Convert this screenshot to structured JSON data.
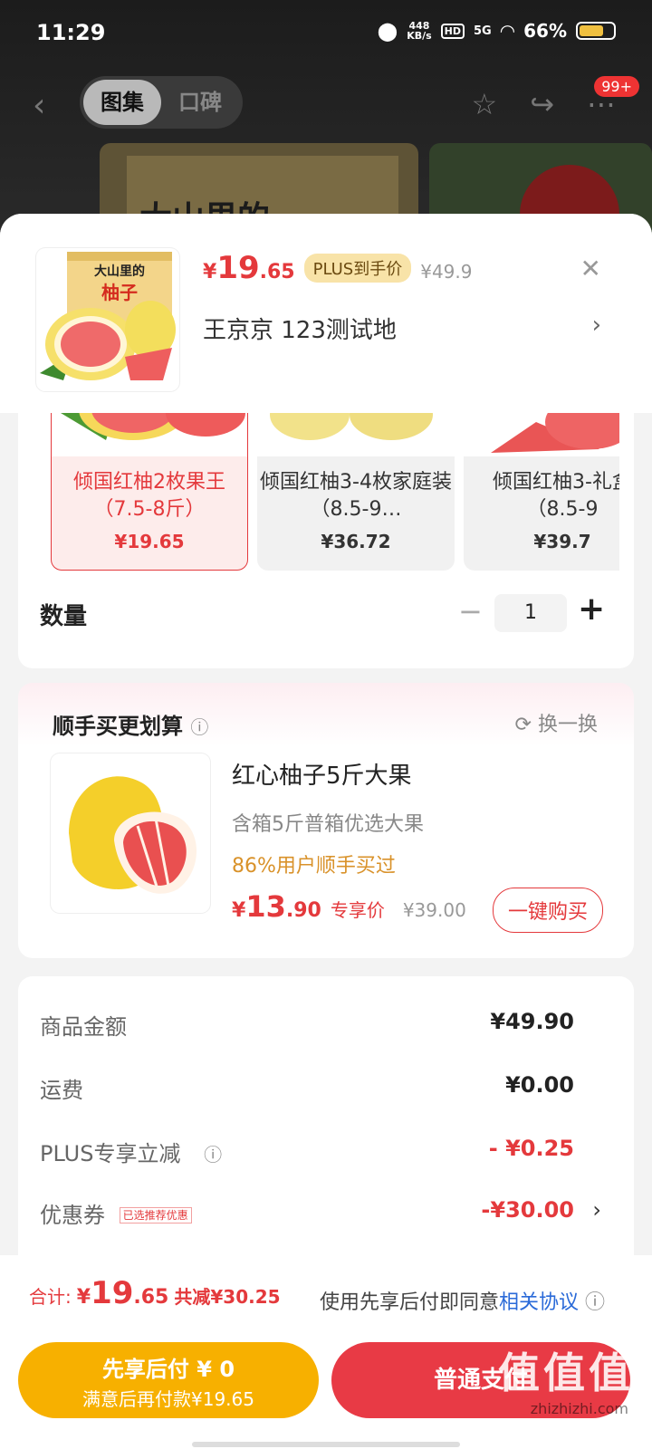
{
  "status": {
    "time": "11:29",
    "netspeed_top": "448",
    "netspeed_unit": "KB/s",
    "hd": "HD",
    "network": "5G",
    "battery": "66%"
  },
  "topnav": {
    "tabs": [
      "图集",
      "口碑"
    ],
    "active_tab": 0,
    "badge": "99+"
  },
  "bg": {
    "box_text": "大山里的"
  },
  "sku_header": {
    "thumb_line1": "大山里的",
    "thumb_line2": "柚子",
    "currency": "¥",
    "price_int": "19",
    "price_dec": ".65",
    "plus_tag": "PLUS到手价",
    "orig_price": "¥49.9",
    "address": "王京京  123测试地"
  },
  "skus": [
    {
      "name": "倾国红柚2枚果王（7.5-8斤）",
      "price": "¥19.65",
      "selected": true
    },
    {
      "name": "倾国红柚3-4枚家庭装（8.5-9…",
      "price": "¥36.72",
      "selected": false
    },
    {
      "name": "倾国红柚3-礼盒（8.5-9",
      "price": "¥39.7",
      "selected": false
    }
  ],
  "quantity": {
    "label": "数量",
    "value": "1"
  },
  "upsell": {
    "title": "顺手买更划算",
    "swap": "换一换",
    "item_title": "红心柚子5斤大果",
    "item_sub": "含箱5斤普箱优选大果",
    "item_sold": "86%用户顺手买过",
    "currency": "¥",
    "price_int": "13",
    "price_dec": ".90",
    "price_tag": "专享价",
    "orig_price": "¥39.00",
    "buy": "一键购买"
  },
  "summary": {
    "goods_label": "商品金额",
    "goods_value": "¥49.90",
    "ship_label": "运费",
    "ship_value": "¥0.00",
    "plus_label": "PLUS专享立减",
    "plus_value": "- ¥0.25",
    "coupon_label": "优惠券",
    "coupon_tag": "已选推荐优惠",
    "coupon_value": "-¥30.00"
  },
  "footer": {
    "total_label": "合计:",
    "currency": "¥",
    "total_int": "19",
    "total_dec": ".65",
    "saved": "共减¥30.25",
    "agree_text": "使用先享后付即同意",
    "agree_link": "相关协议",
    "btn_left_line1": "先享后付 ¥ 0",
    "btn_left_line2": "满意后再付款¥19.65",
    "btn_right": "普通支付",
    "watermark": "值值值",
    "watermark_url": "zhizhizhi.com"
  },
  "colors": {
    "accent_red": "#e4393c",
    "pay_later_yellow": "#f7b000",
    "pay_red": "#e83a45"
  }
}
